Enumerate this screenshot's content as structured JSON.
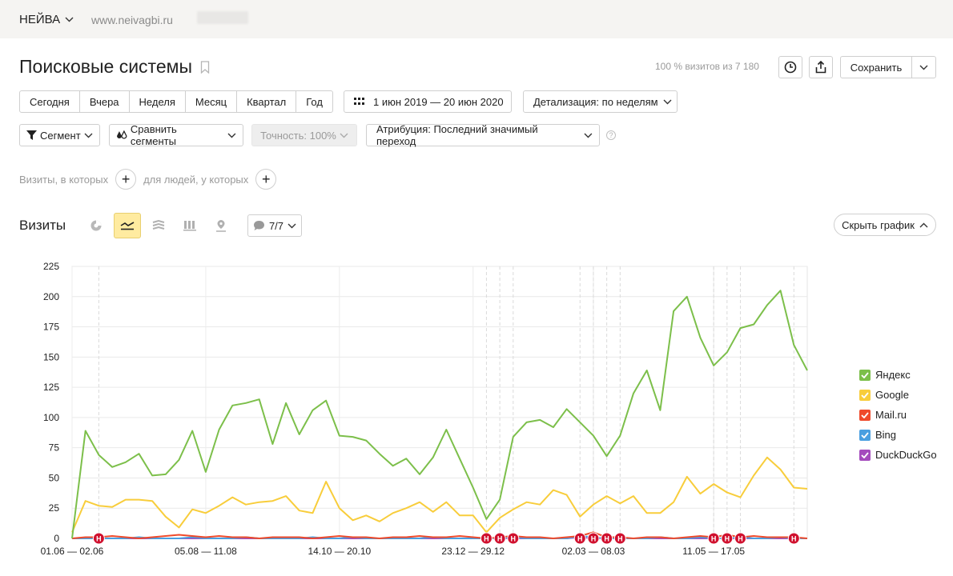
{
  "header": {
    "counter_name": "НЕЙВА",
    "counter_url": "www.neivagbi.ru"
  },
  "report": {
    "title": "Поисковые системы",
    "visits_share": "100 % визитов из 7 180",
    "save_label": "Сохранить"
  },
  "period": {
    "buttons": [
      "Сегодня",
      "Вчера",
      "Неделя",
      "Месяц",
      "Квартал",
      "Год"
    ],
    "date_range": "1 июн 2019 — 20 июн 2020",
    "detail": "Детализация: по неделям"
  },
  "segments": {
    "segment": "Сегмент",
    "compare": "Сравнить сегменты",
    "accuracy": "Точность: 100%",
    "attribution": "Атрибуция: Последний значимый переход",
    "help": "?"
  },
  "filters": {
    "visits_where": "Визиты, в которых",
    "people_where": "для людей, у которых"
  },
  "chart_panel": {
    "title": "Визиты",
    "comments": "7/7",
    "hide_graph": "Скрыть график"
  },
  "colors": {
    "yandex": "#7cbf4a",
    "google": "#f8cd3b",
    "mailru": "#ef4a2b",
    "bing": "#4a9fe0",
    "duckduckgo": "#a44bbd",
    "note_marker": "#d0102e",
    "active_view": "#ffeba0"
  },
  "chart_data": {
    "type": "line",
    "ylim": [
      0,
      225
    ],
    "yticks": [
      0,
      25,
      50,
      75,
      100,
      125,
      150,
      175,
      200,
      225
    ],
    "x_tick_labels": [
      "01.06 — 02.06",
      "05.08 — 11.08",
      "14.10 — 20.10",
      "23.12 — 29.12",
      "02.03 — 08.03",
      "11.05 — 17.05"
    ],
    "x_tick_indices": [
      0,
      10,
      20,
      30,
      39,
      48
    ],
    "n_points": 56,
    "grid": true,
    "legend_position": "right",
    "series": [
      {
        "name": "Яндекс",
        "color_key": "yandex",
        "values": [
          0,
          89,
          69,
          59,
          63,
          70,
          52,
          53,
          65,
          89,
          55,
          90,
          110,
          112,
          115,
          78,
          112,
          86,
          106,
          114,
          85,
          84,
          81,
          70,
          60,
          66,
          53,
          67,
          90,
          66,
          42,
          16,
          32,
          84,
          96,
          98,
          92,
          107,
          96,
          85,
          68,
          85,
          120,
          139,
          106,
          188,
          200,
          166,
          143,
          154,
          174,
          177,
          193,
          205,
          160,
          139
        ]
      },
      {
        "name": "Google",
        "color_key": "google",
        "values": [
          5,
          31,
          27,
          26,
          32,
          32,
          31,
          18,
          9,
          24,
          21,
          27,
          34,
          28,
          30,
          31,
          35,
          23,
          21,
          47,
          25,
          15,
          19,
          14,
          21,
          25,
          30,
          22,
          30,
          19,
          19,
          5,
          17,
          24,
          30,
          28,
          40,
          36,
          18,
          28,
          35,
          29,
          35,
          21,
          21,
          30,
          51,
          37,
          45,
          38,
          34,
          52,
          67,
          57,
          42,
          41
        ]
      },
      {
        "name": "Mail.ru",
        "color_key": "mailru",
        "values": [
          0,
          1,
          1,
          2,
          1,
          0,
          1,
          2,
          3,
          2,
          1,
          2,
          1,
          1,
          0,
          1,
          1,
          1,
          0,
          1,
          2,
          1,
          1,
          0,
          1,
          1,
          2,
          1,
          1,
          2,
          1,
          0,
          1,
          2,
          1,
          1,
          0,
          1,
          2,
          5,
          1,
          1,
          0,
          1,
          1,
          0,
          1,
          2,
          1,
          3,
          1,
          2,
          1,
          1,
          1,
          0
        ]
      },
      {
        "name": "Bing",
        "color_key": "bing",
        "values": [
          0,
          0,
          0,
          0,
          0,
          1,
          0,
          0,
          0,
          1,
          0,
          0,
          0,
          1,
          0,
          0,
          0,
          0,
          1,
          0,
          0,
          1,
          0,
          0,
          0,
          0,
          0,
          1,
          0,
          0,
          0,
          0,
          0,
          1,
          0,
          0,
          0,
          0,
          2,
          1,
          0,
          0,
          0,
          0,
          1,
          0,
          0,
          1,
          0,
          0,
          1,
          0,
          0,
          1,
          0,
          0
        ]
      },
      {
        "name": "DuckDuckGo",
        "color_key": "duckduckgo",
        "values": [
          0,
          0,
          0,
          0,
          0,
          0,
          0,
          0,
          0,
          0,
          0,
          0,
          0,
          0,
          0,
          0,
          0,
          0,
          0,
          0,
          0,
          0,
          0,
          0,
          0,
          0,
          0,
          0,
          0,
          0,
          0,
          0,
          0,
          0,
          0,
          0,
          0,
          0,
          1,
          0,
          0,
          0,
          0,
          0,
          0,
          0,
          0,
          0,
          0,
          0,
          0,
          0,
          0,
          0,
          0,
          0
        ]
      }
    ],
    "note_marker_label": "Н",
    "note_markers": [
      2,
      31,
      32,
      33,
      38,
      39,
      40,
      41,
      48,
      49,
      50,
      54
    ],
    "dashed_gridlines": [
      2,
      31,
      32,
      33,
      38,
      39,
      40,
      41,
      48,
      49,
      50,
      54
    ]
  }
}
